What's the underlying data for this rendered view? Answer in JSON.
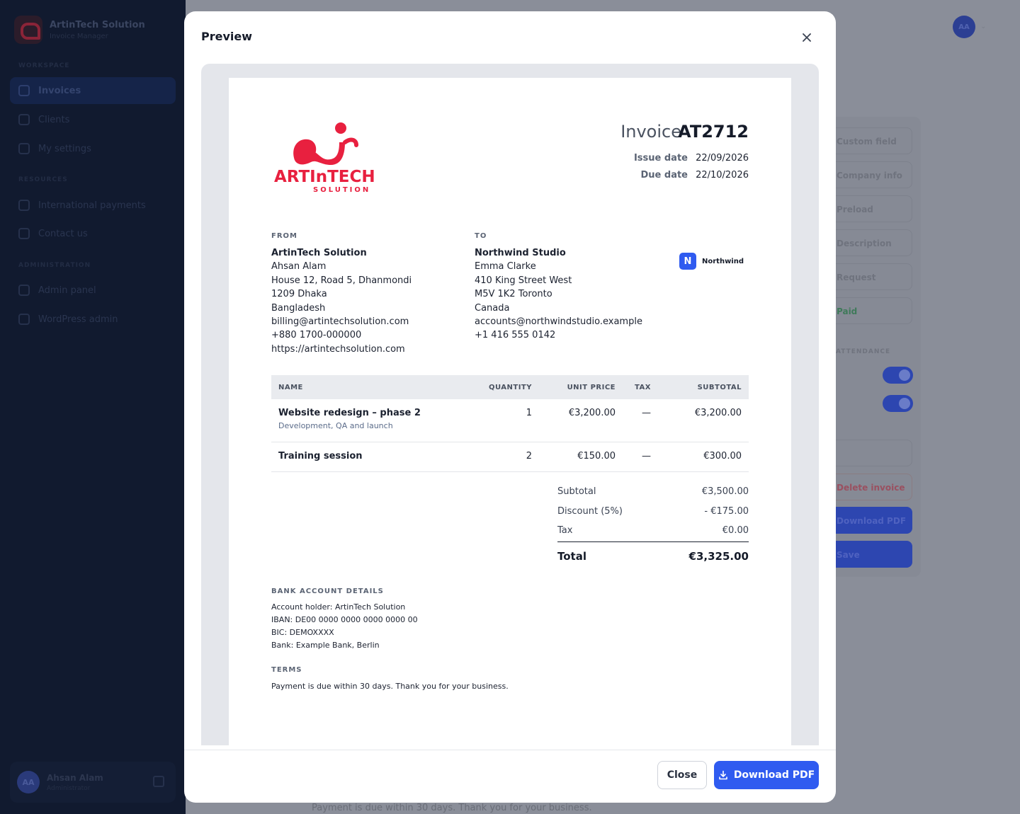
{
  "app": {
    "brand_name": "ArtinTech Solution",
    "brand_sub": "Invoice Manager",
    "sections": {
      "workspace": "WORKSPACE",
      "resources": "RESOURCES",
      "administration": "ADMINISTRATION"
    },
    "nav": {
      "invoices": "Invoices",
      "clients": "Clients",
      "settings": "My settings",
      "payments": "International payments",
      "contact": "Contact us",
      "admin": "Admin panel",
      "wordpress": "WordPress admin"
    },
    "user": {
      "initials": "AA",
      "name": "Ahsan Alam",
      "role": "Administrator"
    },
    "top_avatar": "AA",
    "right_panel": {
      "buttons": [
        "Custom field",
        "Company info",
        "Preload",
        "Description",
        "Request",
        "Paid"
      ],
      "label": "ATTENDANCE",
      "delete": "Delete invoice",
      "download": "Download PDF",
      "save": "Save"
    },
    "bg_footer": "Payment is due within 30 days. Thank you for your business."
  },
  "modal": {
    "title": "Preview",
    "close_label": "Close",
    "download_label": "Download PDF"
  },
  "invoice": {
    "logo_word": "ARTInTECH",
    "logo_sub": "SOLUTION",
    "word": "Invoice",
    "number": "AT2712",
    "issue_label": "Issue date",
    "issue_date": "22/09/2026",
    "due_label": "Due date",
    "due_date": "22/10/2026",
    "from_label": "FROM",
    "from": {
      "company": "ArtinTech Solution",
      "name": "Ahsan Alam",
      "street": "House 12, Road 5, Dhanmondi",
      "city": "1209 Dhaka",
      "country": "Bangladesh",
      "email": "billing@artintechsolution.com",
      "phone": "+880 1700-000000",
      "web": "https://artintechsolution.com"
    },
    "to_label": "TO",
    "to": {
      "company": "Northwind Studio",
      "name": "Emma Clarke",
      "street": "410 King Street West",
      "city": "M5V 1K2 Toronto",
      "country": "Canada",
      "email": "accounts@northwindstudio.example",
      "phone": "+1 416 555 0142"
    },
    "client_badge": {
      "letter": "N",
      "name": "Northwind"
    },
    "columns": {
      "name": "NAME",
      "quantity": "QUANTITY",
      "unit_price": "UNIT PRICE",
      "tax": "TAX",
      "subtotal": "SUBTOTAL"
    },
    "items": [
      {
        "name": "Website redesign – phase 2",
        "desc": "Development, QA and launch",
        "qty": "1",
        "unit": "€3,200.00",
        "tax": "—",
        "subtotal": "€3,200.00"
      },
      {
        "name": "Training session",
        "desc": "",
        "qty": "2",
        "unit": "€150.00",
        "tax": "—",
        "subtotal": "€300.00"
      }
    ],
    "totals": {
      "subtotal_label": "Subtotal",
      "subtotal": "€3,500.00",
      "discount_label": "Discount (5%)",
      "discount": "- €175.00",
      "tax_label": "Tax",
      "tax": "€0.00",
      "total_label": "Total",
      "total": "€3,325.00"
    },
    "bank_label": "BANK ACCOUNT DETAILS",
    "bank": {
      "holder": "Account holder: ArtinTech Solution",
      "iban": "IBAN: DE00 0000 0000 0000 0000 00",
      "bic": "BIC: DEMOXXXX",
      "bank": "Bank: Example Bank, Berlin"
    },
    "terms_label": "TERMS",
    "terms": "Payment is due within 30 days. Thank you for your business."
  },
  "colors": {
    "accent": "#2f5bf0",
    "logo_red": "#e8203f",
    "sidebar": "#111a2f"
  }
}
